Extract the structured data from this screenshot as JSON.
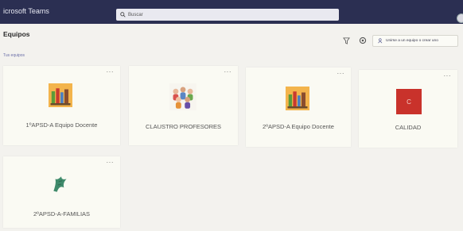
{
  "app": {
    "title": "icrosoft Teams"
  },
  "search": {
    "placeholder": "Buscar"
  },
  "header": {
    "title": "Equipos",
    "section_label": "Tus equipos"
  },
  "toolbar": {
    "join_label": "Unirse a un equipo o crear uno"
  },
  "teams": [
    {
      "name": "1ºAPSD-A Equipo Docente",
      "logo": "books-icon"
    },
    {
      "name": "CLAUSTRO PROFESORES",
      "logo": "people-group-icon"
    },
    {
      "name": "2ºAPSD-A Equipo Docente",
      "logo": "books-icon"
    },
    {
      "name": "CALIDAD",
      "logo": "letter-tile-icon",
      "initial": "C",
      "color": "#c9322b"
    },
    {
      "name": "2ºAPSD-A-FAMILIAS",
      "logo": "green-figure-icon"
    }
  ],
  "more_label": "···"
}
